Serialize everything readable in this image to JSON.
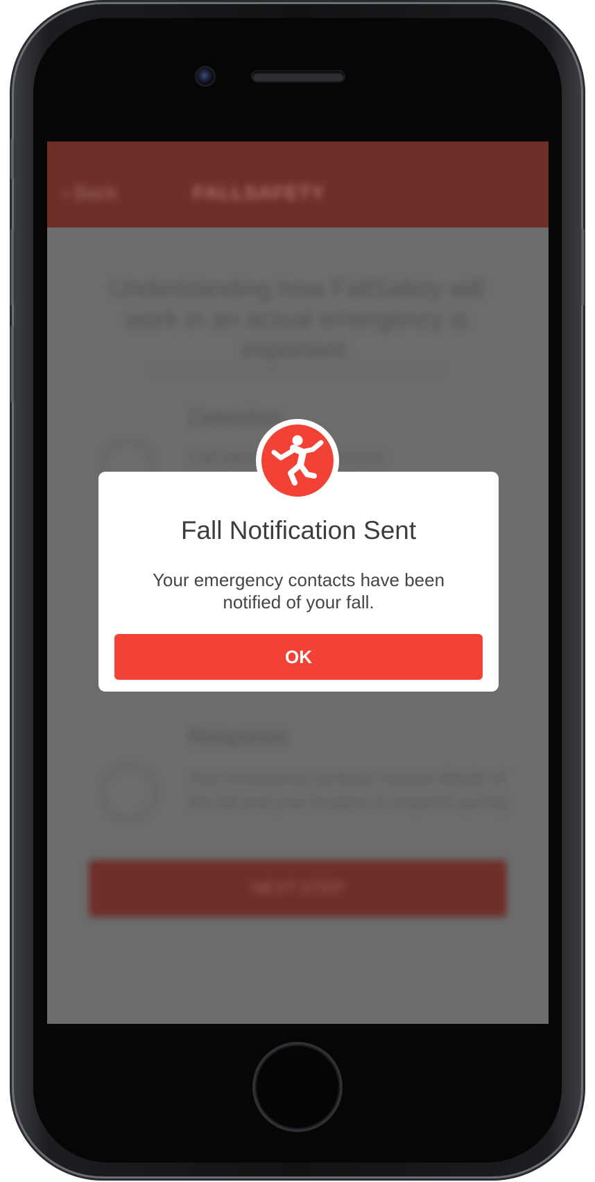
{
  "background_screen": {
    "header": {
      "back_label": "Back",
      "logo_text": "FALLSAFETY"
    },
    "heading": "Understanding how FallSafety will work in an actual emergency is important.",
    "sections": [
      {
        "title": "Detection",
        "text": "Fall detected by sensors"
      },
      {
        "title": "Response",
        "text": "Your emergency contacts receive details of the fall and your location to respond quickly."
      }
    ],
    "bottom_button_label": "NEXT STEP"
  },
  "dialog": {
    "icon": "falling-person-icon",
    "title": "Fall Notification Sent",
    "message": "Your emergency contacts have been notified of your fall.",
    "ok_label": "OK"
  },
  "colors": {
    "accent": "#f24236",
    "overlay": "#6c6c6c",
    "title_text": "#3d3d3d"
  }
}
